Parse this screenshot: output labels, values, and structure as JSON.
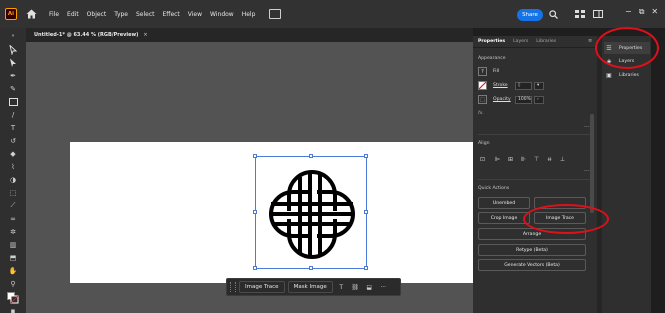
{
  "app": {
    "logo": "Ai"
  },
  "menu": [
    "File",
    "Edit",
    "Object",
    "Type",
    "Select",
    "Effect",
    "View",
    "Window",
    "Help"
  ],
  "menubar": {
    "share_label": "Share"
  },
  "document": {
    "tab_title": "Untitled-1* @ 63.44 % (RGB/Preview)",
    "tab_close": "×"
  },
  "taskbar": {
    "image_trace": "Image Trace",
    "mask_image": "Mask Image",
    "more": "···"
  },
  "props": {
    "tabs": [
      "Properties",
      "Layers",
      "Libraries"
    ],
    "appearance": {
      "title": "Appearance",
      "fill_label": "Fill",
      "stroke_label": "Stroke",
      "opacity_label": "Opacity",
      "opacity_value": "100%",
      "fx_label": "fx."
    },
    "align": {
      "title": "Align"
    },
    "quick_actions": {
      "title": "Quick Actions",
      "unembed": "Unembed",
      "crop_image": "Crop Image",
      "image_trace": "Image Trace",
      "arrange": "Arrange",
      "retype": "Retype (Beta)",
      "generate_vectors": "Generate Vectors (Beta)"
    },
    "more": "···"
  },
  "dock": {
    "items": [
      "Properties",
      "Layers",
      "Libraries"
    ]
  },
  "colors": {
    "accent": "#1473e6",
    "annotation": "#e0101a",
    "selection": "#4a7bd9"
  }
}
